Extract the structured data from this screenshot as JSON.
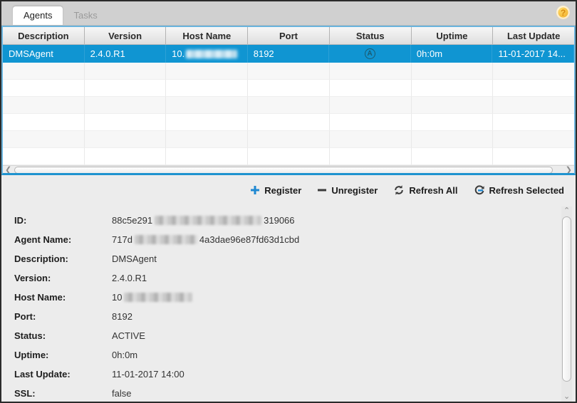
{
  "tabs": [
    {
      "label": "Agents",
      "active": true
    },
    {
      "label": "Tasks",
      "active": false
    }
  ],
  "help": {
    "glyph": "?"
  },
  "table": {
    "columns": [
      "Description",
      "Version",
      "Host Name",
      "Port",
      "Status",
      "Uptime",
      "Last Update"
    ],
    "selected_row": {
      "description": "DMSAgent",
      "version": "2.4.0.R1",
      "host_name_prefix": "10.",
      "host_name_redacted": true,
      "port": "8192",
      "status_icon_letter": "A",
      "uptime": "0h:0m",
      "last_update": "11-01-2017 14..."
    },
    "empty_row_count": 6
  },
  "scrollbars": {
    "h_left": "❮",
    "h_right": "❯",
    "v_up": "⌃",
    "v_down": "⌄"
  },
  "toolbar": {
    "register_label": "Register",
    "unregister_label": "Unregister",
    "refresh_all_label": "Refresh All",
    "refresh_selected_label": "Refresh Selected"
  },
  "details": {
    "rows": [
      {
        "label": "ID:",
        "value_prefix": "88c5e291",
        "redacted": true,
        "value_suffix": "319066"
      },
      {
        "label": "Agent Name:",
        "value_prefix": "717d",
        "redacted": true,
        "value_suffix": "4a3dae96e87fd63d1cbd"
      },
      {
        "label": "Description:",
        "value": "DMSAgent"
      },
      {
        "label": "Version:",
        "value": "2.4.0.R1"
      },
      {
        "label": "Host Name:",
        "value_prefix": "10",
        "redacted": true,
        "value_suffix": ""
      },
      {
        "label": "Port:",
        "value": "8192"
      },
      {
        "label": "Status:",
        "value": "ACTIVE"
      },
      {
        "label": "Uptime:",
        "value": "0h:0m"
      },
      {
        "label": "Last Update:",
        "value": "11-01-2017 14:00"
      },
      {
        "label": "SSL:",
        "value": "false"
      }
    ]
  },
  "colors": {
    "selection_blue": "#1095d2",
    "table_border_blue": "#6ab4dd",
    "accent_blue": "#1e88d2",
    "help_gold": "#f3b32c",
    "panel_gray": "#ececec"
  }
}
